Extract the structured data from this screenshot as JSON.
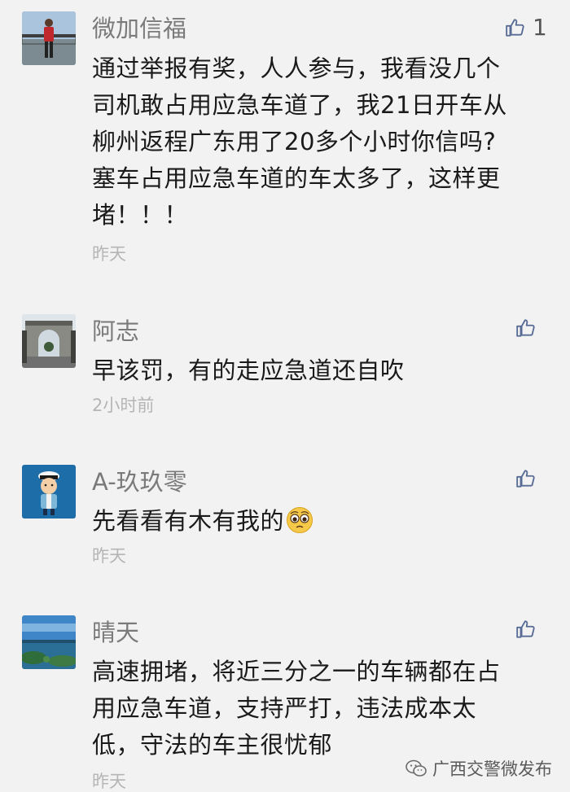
{
  "comments": [
    {
      "author": "微加信福",
      "lines": [
        "通过举报有奖，人人参与，我看没几个",
        "司机敢占用应急车道了，我21日开车从",
        "柳州返程广东用了20多个小时你信吗?",
        "塞车占用应急车道的车太多了，这样更",
        "堵！！！"
      ],
      "time": "昨天",
      "like_count": "1",
      "avatar_icon": "avatar-person-standing"
    },
    {
      "author": "阿志",
      "lines": [
        "早该罚，有的走应急道还自吹"
      ],
      "time": "2小时前",
      "like_count": "",
      "avatar_icon": "avatar-stone-arch"
    },
    {
      "author": "A-玖玖零",
      "lines": [
        "先看看有木有我的"
      ],
      "time": "昨天",
      "like_count": "",
      "avatar_icon": "avatar-traffic-police-cartoon",
      "emoji": "pleading-face-emoji"
    },
    {
      "author": "晴天",
      "lines": [
        "高速拥堵，将近三分之一的车辆都在占",
        "用应急车道，支持严打，违法成本太",
        "低，守法的车主很忧郁"
      ],
      "time": "昨天",
      "like_count": "",
      "avatar_icon": "avatar-seaside-landscape"
    }
  ],
  "watermark": {
    "text": "广西交警微发布",
    "icon": "wechat-icon"
  },
  "colors": {
    "background": "#f2f2f2",
    "author": "#7a7a7a",
    "content": "#1a1a1a",
    "time": "#b5b5b5",
    "like_icon": "#576b95"
  }
}
